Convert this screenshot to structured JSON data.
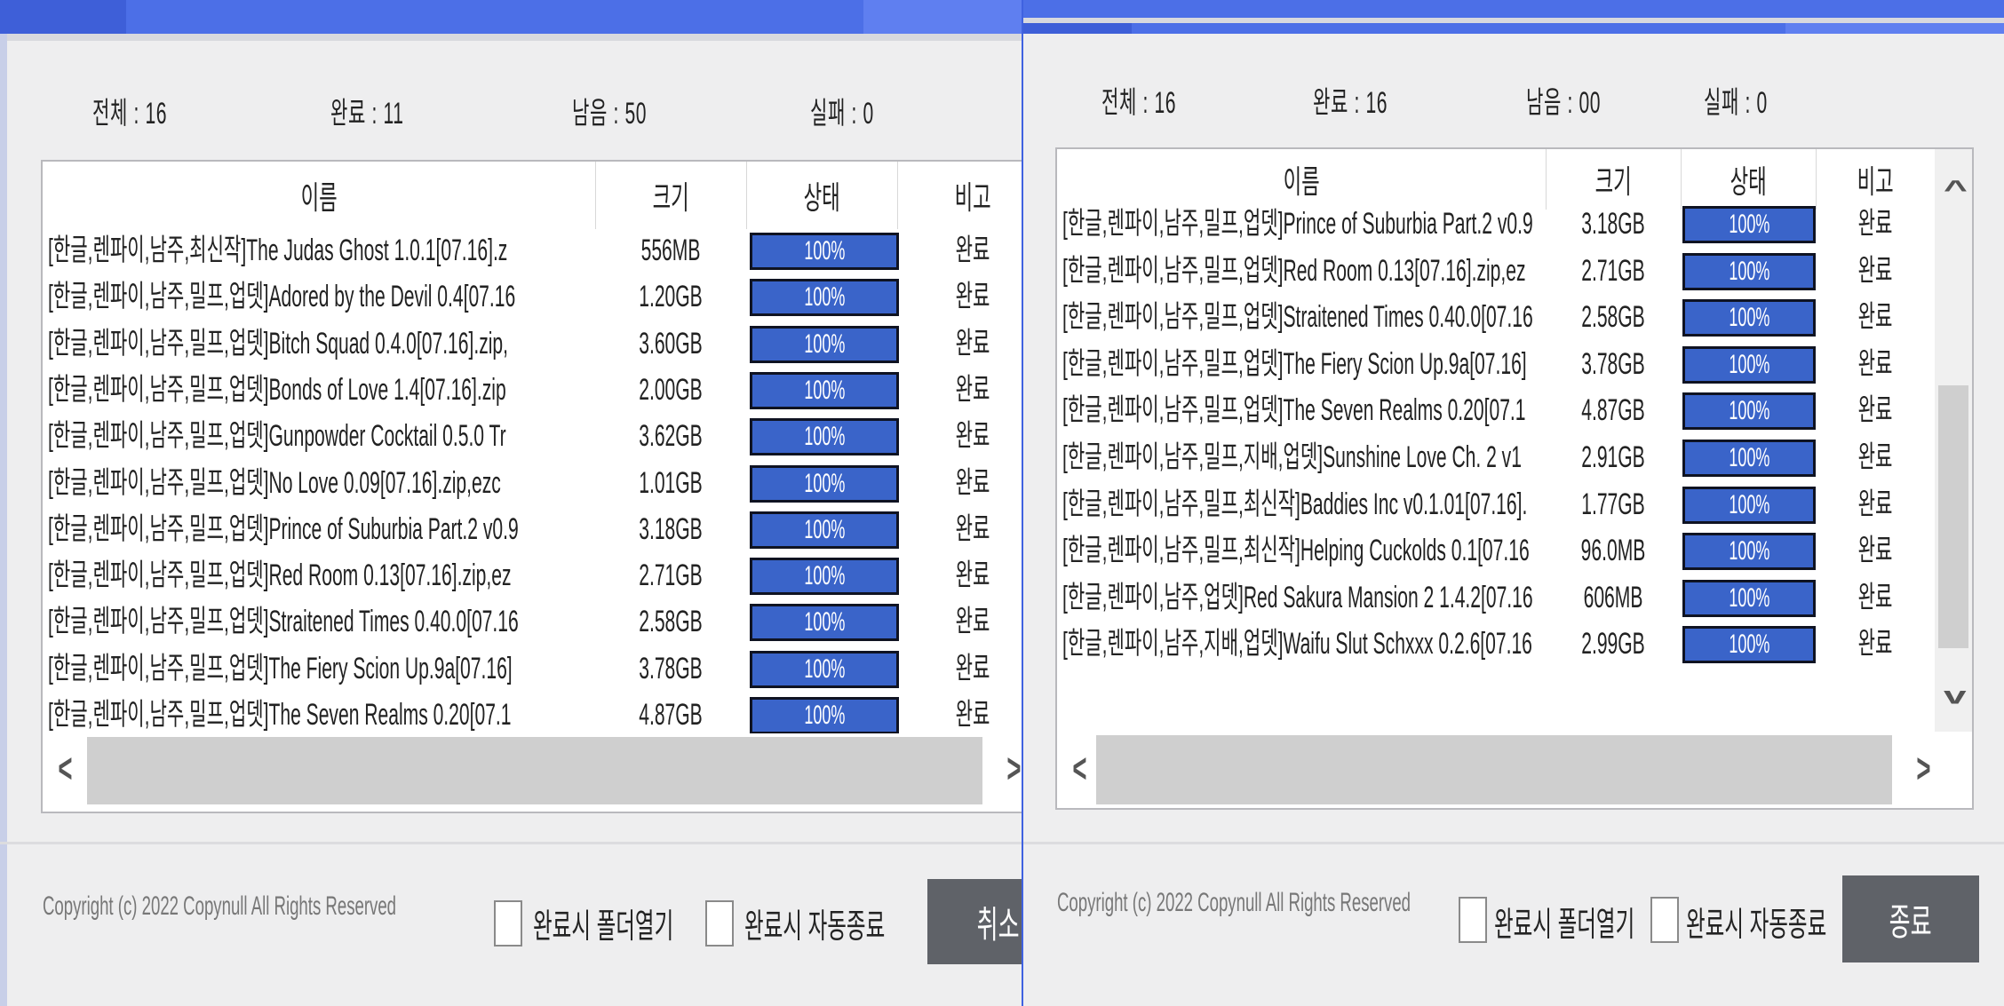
{
  "colors": {
    "accent": "#4c6fe7",
    "progress": "#3a64c9",
    "button": "#5f6268"
  },
  "left": {
    "stats": {
      "total": "전체 : 16",
      "done": "완료 : 11",
      "remaining": "남음 : 50",
      "failed": "실패 : 0"
    },
    "columns": [
      "이름",
      "크기",
      "상태",
      "비고"
    ],
    "rows": [
      {
        "name": "[한글,렌파이,남주,최신작]The Judas Ghost 1.0.1[07.16].z",
        "size": "556MB",
        "status": "100%",
        "note": "완료"
      },
      {
        "name": "[한글,렌파이,남주,밀프,업뎃]Adored by the Devil 0.4[07.16",
        "size": "1.20GB",
        "status": "100%",
        "note": "완료"
      },
      {
        "name": "[한글,렌파이,남주,밀프,업뎃]Bitch Squad 0.4.0[07.16].zip,",
        "size": "3.60GB",
        "status": "100%",
        "note": "완료"
      },
      {
        "name": "[한글,렌파이,남주,밀프,업뎃]Bonds of Love 1.4[07.16].zip",
        "size": "2.00GB",
        "status": "100%",
        "note": "완료"
      },
      {
        "name": "[한글,렌파이,남주,밀프,업뎃]Gunpowder Cocktail 0.5.0 Tr",
        "size": "3.62GB",
        "status": "100%",
        "note": "완료"
      },
      {
        "name": "[한글,렌파이,남주,밀프,업뎃]No Love 0.09[07.16].zip,ezc",
        "size": "1.01GB",
        "status": "100%",
        "note": "완료"
      },
      {
        "name": "[한글,렌파이,남주,밀프,업뎃]Prince of Suburbia Part.2 v0.9",
        "size": "3.18GB",
        "status": "100%",
        "note": "완료"
      },
      {
        "name": "[한글,렌파이,남주,밀프,업뎃]Red Room 0.13[07.16].zip,ez",
        "size": "2.71GB",
        "status": "100%",
        "note": "완료"
      },
      {
        "name": "[한글,렌파이,남주,밀프,업뎃]Straitened Times 0.40.0[07.16",
        "size": "2.58GB",
        "status": "100%",
        "note": "완료"
      },
      {
        "name": "[한글,렌파이,남주,밀프,업뎃]The Fiery Scion Up.9a[07.16]",
        "size": "3.78GB",
        "status": "100%",
        "note": "완료"
      },
      {
        "name": "[한글,렌파이,남주,밀프,업뎃]The Seven Realms 0.20[07.1",
        "size": "4.87GB",
        "status": "100%",
        "note": "완료"
      }
    ],
    "footer": {
      "copyright": "Copyright (c) 2022 Copynull All Rights Reserved",
      "open_folder": "완료시 폴더열기",
      "auto_exit": "완료시 자동종료",
      "button": "취소"
    }
  },
  "right": {
    "stats": {
      "total": "전체 : 16",
      "done": "완료 : 16",
      "remaining": "남음 : 00",
      "failed": "실패 : 0"
    },
    "columns": [
      "이름",
      "크기",
      "상태",
      "비고"
    ],
    "rows": [
      {
        "name": "[한글,렌파이,남주,밀프,업뎃]Prince of Suburbia Part.2 v0.9",
        "size": "3.18GB",
        "status": "100%",
        "note": "완료"
      },
      {
        "name": "[한글,렌파이,남주,밀프,업뎃]Red Room 0.13[07.16].zip,ez",
        "size": "2.71GB",
        "status": "100%",
        "note": "완료"
      },
      {
        "name": "[한글,렌파이,남주,밀프,업뎃]Straitened Times 0.40.0[07.16",
        "size": "2.58GB",
        "status": "100%",
        "note": "완료"
      },
      {
        "name": "[한글,렌파이,남주,밀프,업뎃]The Fiery Scion Up.9a[07.16]",
        "size": "3.78GB",
        "status": "100%",
        "note": "완료"
      },
      {
        "name": "[한글,렌파이,남주,밀프,업뎃]The Seven Realms 0.20[07.1",
        "size": "4.87GB",
        "status": "100%",
        "note": "완료"
      },
      {
        "name": "[한글,렌파이,남주,밀프,지배,업뎃]Sunshine Love Ch. 2 v1",
        "size": "2.91GB",
        "status": "100%",
        "note": "완료"
      },
      {
        "name": "[한글,렌파이,남주,밀프,최신작]Baddies Inc v0.1.01[07.16].",
        "size": "1.77GB",
        "status": "100%",
        "note": "완료"
      },
      {
        "name": "[한글,렌파이,남주,밀프,최신작]Helping Cuckolds 0.1[07.16",
        "size": "96.0MB",
        "status": "100%",
        "note": "완료"
      },
      {
        "name": "[한글,렌파이,남주,업뎃]Red Sakura Mansion 2 1.4.2[07.16",
        "size": "606MB",
        "status": "100%",
        "note": "완료"
      },
      {
        "name": "[한글,렌파이,남주,지배,업뎃]Waifu Slut Schxxx 0.2.6[07.16",
        "size": "2.99GB",
        "status": "100%",
        "note": "완료"
      }
    ],
    "footer": {
      "copyright": "Copyright (c) 2022 Copynull All Rights Reserved",
      "open_folder": "완료시 폴더열기",
      "auto_exit": "완료시 자동종료",
      "button": "종료"
    }
  }
}
